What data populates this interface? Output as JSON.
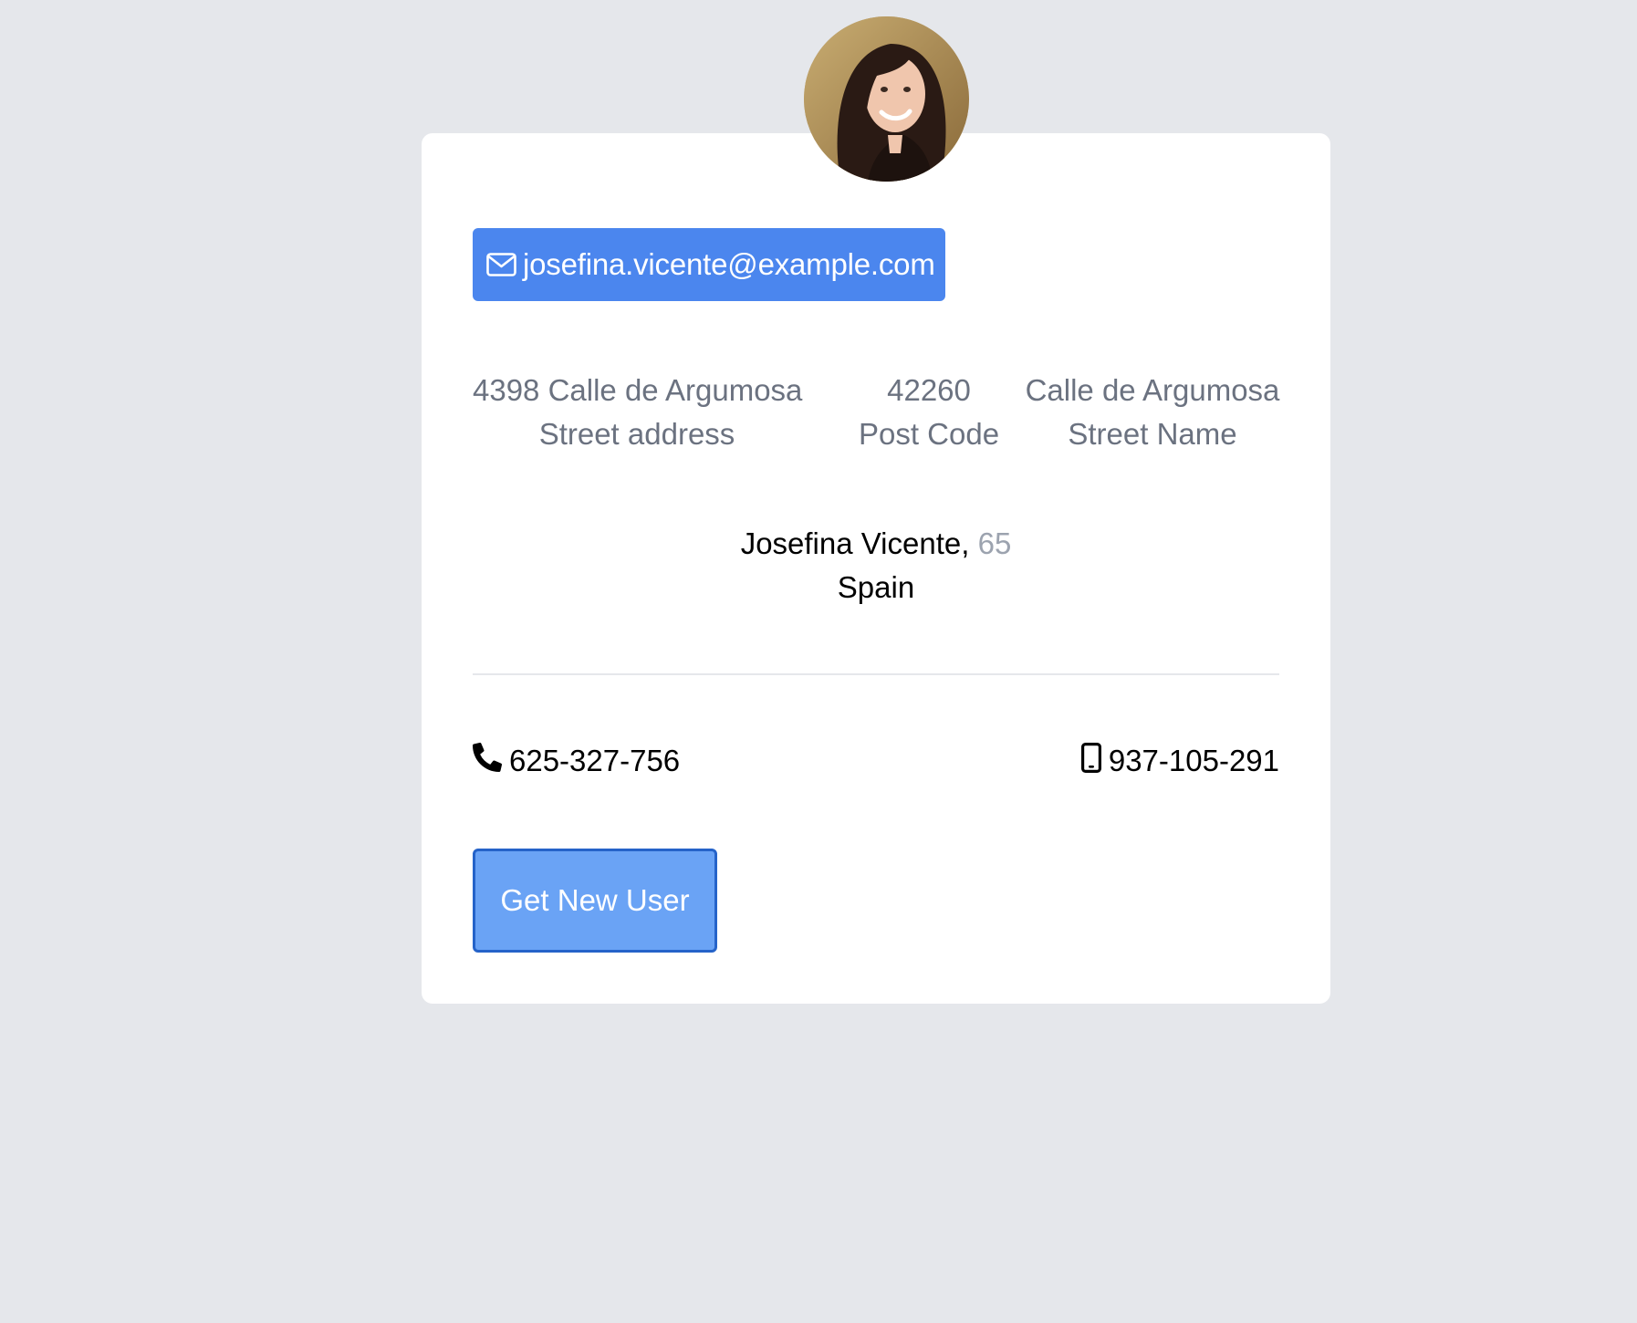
{
  "user": {
    "email": "josefina.vicente@example.com",
    "name": "Josefina Vicente,",
    "age": "65",
    "country": "Spain",
    "phone": "625-327-756",
    "cell": "937-105-291"
  },
  "address": {
    "street_address": "4398 Calle de Argumosa",
    "street_address_label": "Street address",
    "post_code": "42260",
    "post_code_label": "Post Code",
    "street_name": "Calle de Argumosa",
    "street_name_label": "Street Name"
  },
  "actions": {
    "new_user_label": "Get New User"
  },
  "icons": {
    "email": "envelope-icon",
    "phone": "phone-icon",
    "cell": "mobile-phone-icon"
  },
  "colors": {
    "page_background": "#e5e7eb",
    "card_background": "#ffffff",
    "email_button": "#4b86ee",
    "new_user_button": "#6aa3f5",
    "new_user_border": "#2563c9",
    "muted_text": "#6b7280",
    "age_text": "#9ca3af"
  }
}
